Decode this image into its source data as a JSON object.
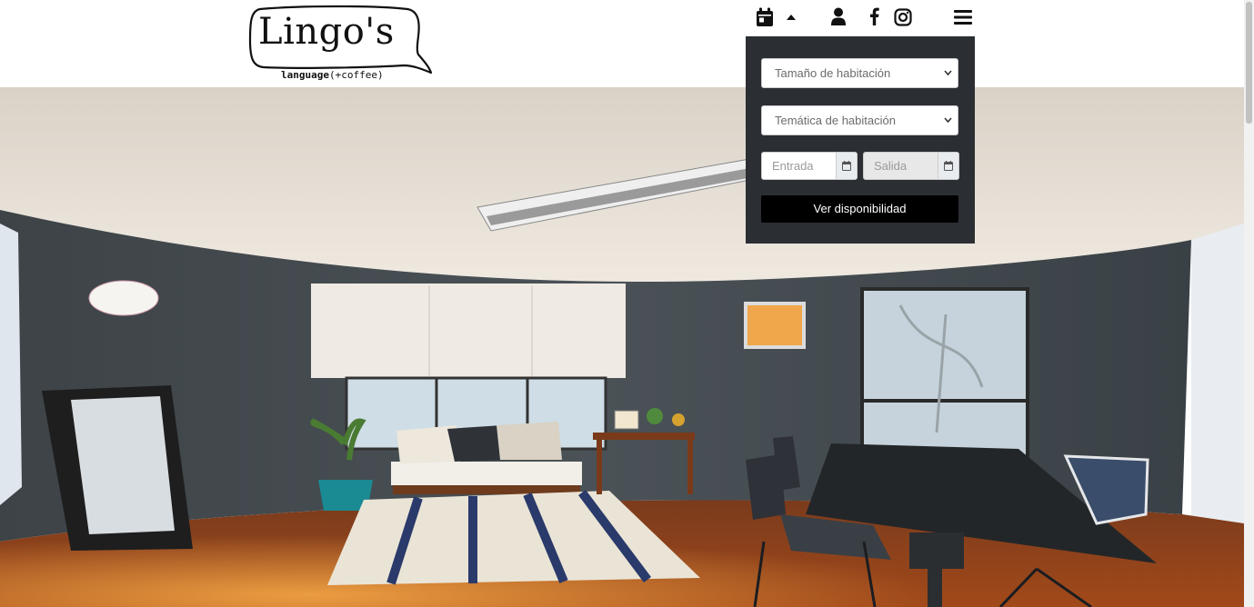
{
  "brand": {
    "name": "Lingo's",
    "tagline_bold": "language",
    "tagline_rest": "(+coffee)"
  },
  "nav": {
    "icons": [
      "calendar-icon",
      "caret-up-icon",
      "user-icon",
      "facebook-icon",
      "instagram-icon",
      "menu-icon"
    ]
  },
  "booking": {
    "room_size_placeholder": "Tamaño de habitación",
    "room_theme_placeholder": "Temática de habitación",
    "checkin_placeholder": "Entrada",
    "checkout_placeholder": "Salida",
    "submit_label": "Ver disponibilidad"
  },
  "colors": {
    "panel_bg": "#2b2e33",
    "button_bg": "#000000",
    "button_text": "#ffffff"
  }
}
